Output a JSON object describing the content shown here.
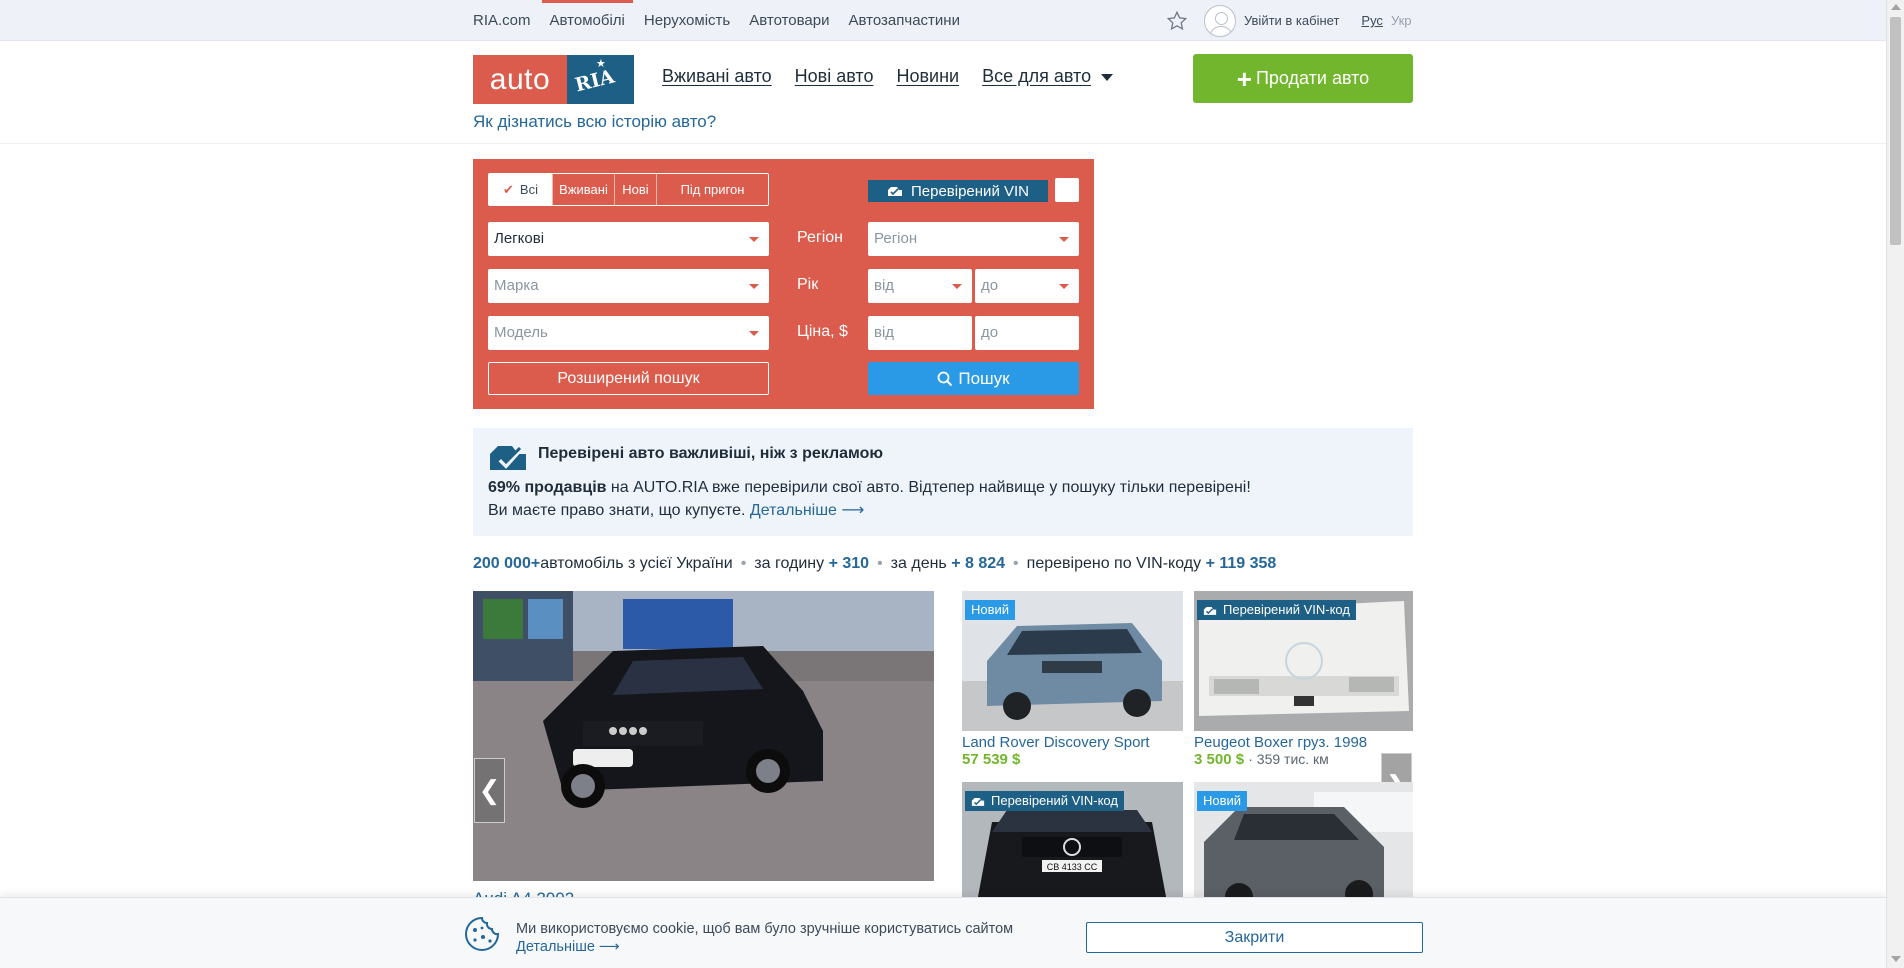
{
  "topnav": {
    "items": [
      "RIA.com",
      "Автомобілі",
      "Нерухомість",
      "Автотовари",
      "Автозапчастини"
    ],
    "login": "Увійти в кабінет",
    "lang_ru": "Рус",
    "lang_ua": "Укр"
  },
  "header": {
    "logo_auto": "auto",
    "logo_ria": "RIA",
    "nav": [
      "Вживані авто",
      "Нові авто",
      "Новини",
      "Все для авто"
    ],
    "history_link": "Як дізнатись всю історію авто?",
    "sell_button": "Продати авто"
  },
  "search": {
    "tabs": [
      "Всі",
      "Вживані",
      "Нові",
      "Під пригон"
    ],
    "vin_button": "Перевірений VIN",
    "type_value": "Легкові",
    "brand_placeholder": "Марка",
    "model_placeholder": "Модель",
    "region_label": "Регіон",
    "region_placeholder": "Регіон",
    "year_label": "Рік",
    "year_from": "від",
    "year_to": "до",
    "price_label": "Ціна, $",
    "price_from": "від",
    "price_to": "до",
    "extended_button": "Розширений пошук",
    "search_button": "Пошук"
  },
  "info": {
    "title": "Перевірені авто важливіші, ніж з рекламою",
    "line1_bold": "69% продавців",
    "line1_rest": " на AUTO.RIA вже перевірили свої авто. Відтепер найвище у пошуку тільки перевірені!",
    "line2_text": "Ви маєте право знати, що купуєте. ",
    "line2_link": "Детальніше ⟶"
  },
  "stats": {
    "total": "200 000+",
    "total_text": " автомобіль з усієї України",
    "hour_text": "за годину ",
    "hour": "+ 310",
    "day_text": "за день ",
    "day": "+ 8 824",
    "vin_text": "перевірено по VIN-коду ",
    "vin": "+ 119 358"
  },
  "cars": {
    "main_caption": "Audi A4 2002",
    "items": [
      {
        "badge": "Новий",
        "title": "Land Rover Discovery Sport",
        "price": "57 539 $",
        "mileage": ""
      },
      {
        "badge": "Перевірений VIN-код",
        "title": "Peugeot Boxer груз. 1998",
        "price": "3 500 $",
        "mileage": "359 тис. км"
      },
      {
        "badge": "Перевірений VIN-код",
        "plate": "CB 4133 CC"
      },
      {
        "badge": "Новий"
      }
    ]
  },
  "cookie": {
    "text": "Ми використовуємо cookie, щоб вам було зручніше користуватись сайтом",
    "more": "Детальніше ⟶",
    "close": "Закрити"
  },
  "colors": {
    "brand_red": "#db5c4c",
    "brand_blue": "#1e5f86",
    "sell_green": "#72b62d",
    "search_blue": "#2a9ae6",
    "link_blue": "#256799"
  }
}
